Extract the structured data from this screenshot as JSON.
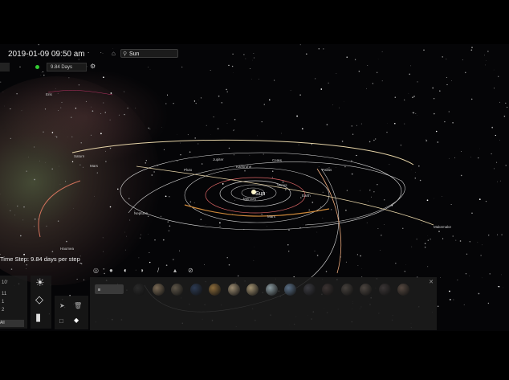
{
  "header": {
    "datetime": "2019-01-09 09:50 am",
    "time_rate": "9.84 Days",
    "search_value": "Sun"
  },
  "status": {
    "time_step": "Time Step: 9.84 days per step"
  },
  "bodies": {
    "sun": "Sun",
    "mercury": "Mercury",
    "venus": "Venus",
    "earth": "Earth",
    "mars": "Mars",
    "ceres": "Ceres",
    "pallas": "Pallas",
    "jupiter": "Jupiter",
    "saturn": "Saturn",
    "uranus": "Uranus",
    "neptune": "Neptune",
    "pluto": "Pluto",
    "haumea": "Haumea",
    "makemake": "Makemake",
    "eris": "Eris",
    "sedna": "Sedna",
    "karlsruhe": "Karlsruhe"
  },
  "left_panel": {
    "rows": [
      "10",
      "11",
      "1",
      "2"
    ],
    "slot_label": "All"
  },
  "icons": {
    "brightness": "sun-icon",
    "grid": "plane-grid-icon",
    "stats": "bar-chart-icon",
    "pointer": "cursor-icon",
    "trash": "trash-icon",
    "square": "select-box-icon",
    "sticky": "sticky-icon"
  },
  "planet_colors": [
    "#2a2a2a",
    "#7a6a55",
    "#5d5548",
    "#2c3a52",
    "#8a6a3a",
    "#9a8a70",
    "#a09070",
    "#8a9aa0",
    "#5a6f86",
    "#3a3a40",
    "#3b3332",
    "#45403c",
    "#4c4540",
    "#3a3535",
    "#554840"
  ]
}
